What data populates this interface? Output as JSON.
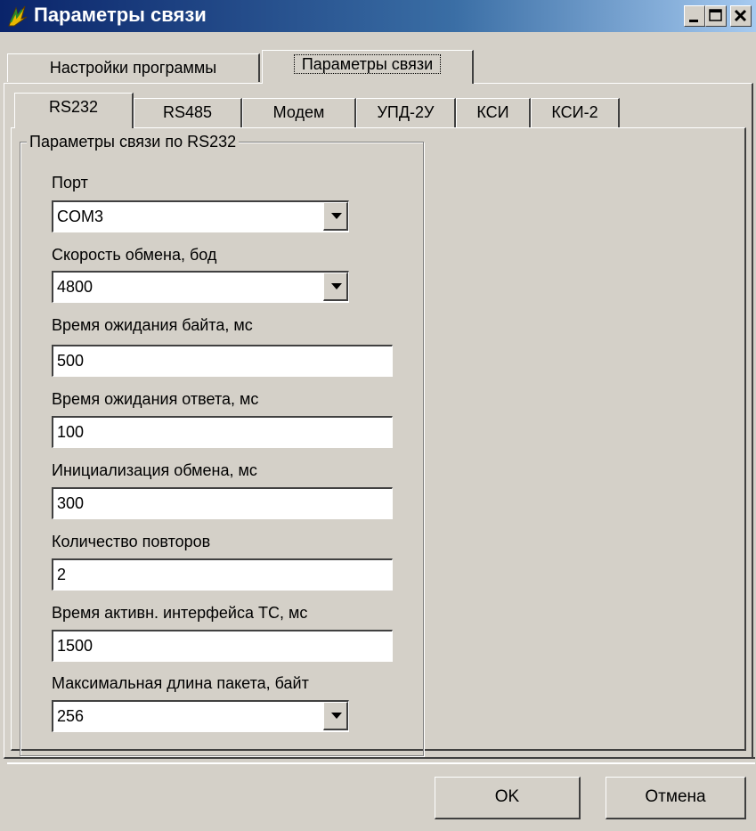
{
  "window": {
    "title": "Параметры связи",
    "title_bar_color": "#0a246a",
    "face_color": "#d4d0c8"
  },
  "top_tabs": [
    {
      "label": "Настройки программы",
      "active": false
    },
    {
      "label": "Параметры связи",
      "active": true
    }
  ],
  "sub_tabs": [
    {
      "label": "RS232",
      "active": true
    },
    {
      "label": "RS485",
      "active": false
    },
    {
      "label": "Модем",
      "active": false
    },
    {
      "label": "УПД-2У",
      "active": false
    },
    {
      "label": "КСИ",
      "active": false
    },
    {
      "label": "КСИ-2",
      "active": false
    }
  ],
  "group": {
    "title": "Параметры связи по RS232",
    "fields": [
      {
        "label": "Порт",
        "value": "COM3",
        "kind": "combo"
      },
      {
        "label": "Скорость обмена, бод",
        "value": "4800",
        "kind": "combo"
      },
      {
        "label": "Время ожидания байта, мс",
        "value": "500",
        "kind": "edit"
      },
      {
        "label": "Время ожидания ответа, мс",
        "value": "100",
        "kind": "edit"
      },
      {
        "label": "Инициализация обмена, мс",
        "value": "300",
        "kind": "edit"
      },
      {
        "label": "Количество повторов",
        "value": "2",
        "kind": "edit"
      },
      {
        "label": "Время активн. интерфейса ТС, мс",
        "value": "1500",
        "kind": "edit"
      },
      {
        "label": "Максимальная длина пакета, байт",
        "value": "256",
        "kind": "combo"
      }
    ]
  },
  "buttons": {
    "ok": "OK",
    "cancel": "Отмена"
  },
  "icons": {
    "app": "app-icon",
    "minimize": "minimize-icon",
    "maximize": "maximize-icon",
    "close": "close-icon",
    "dropdown": "chevron-down-icon"
  }
}
